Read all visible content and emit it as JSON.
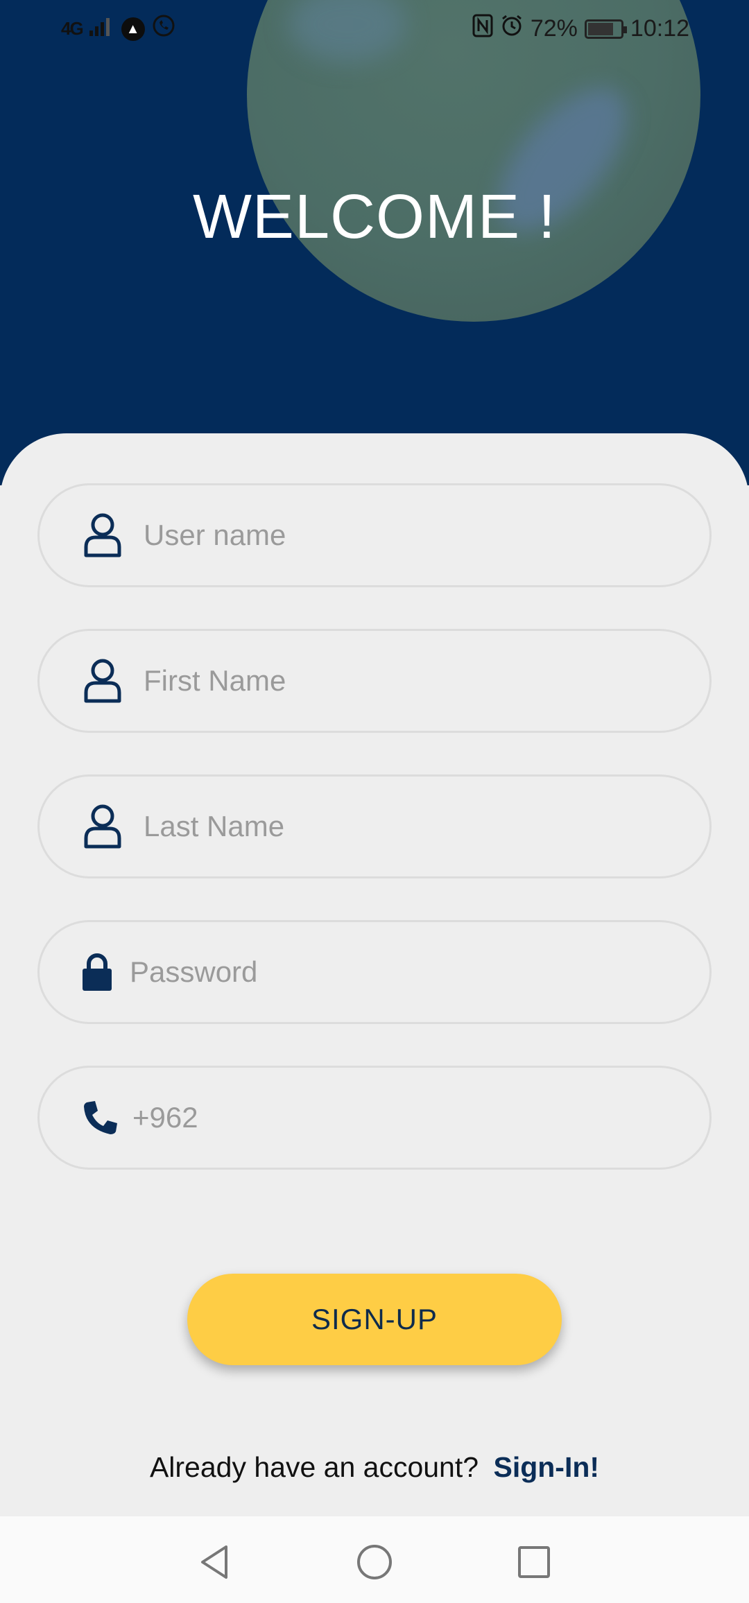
{
  "status_bar": {
    "network": "4G",
    "battery_percent": "72%",
    "time": "10:12"
  },
  "header": {
    "title": "WELCOME !"
  },
  "form": {
    "username": {
      "placeholder": "User name",
      "icon": "person-icon"
    },
    "first_name": {
      "placeholder": "First Name",
      "icon": "person-icon"
    },
    "last_name": {
      "placeholder": "Last Name",
      "icon": "person-icon"
    },
    "password": {
      "placeholder": "Password",
      "icon": "lock-icon"
    },
    "phone": {
      "placeholder": "+962",
      "icon": "phone-icon"
    }
  },
  "signup_button": {
    "label": "SIGN-UP"
  },
  "signin": {
    "prompt": "Already have an account?",
    "link": "Sign-In!"
  },
  "colors": {
    "header_bg": "#032b5a",
    "accent": "#fecd45",
    "icon": "#0b2d57"
  }
}
